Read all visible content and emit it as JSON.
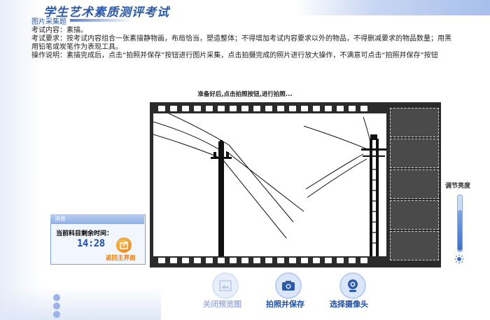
{
  "header": {
    "title": "学生艺术素质测评考试",
    "section_label": "图片采集题"
  },
  "instructions": {
    "line1": "考试内容：素描。",
    "line2": "考试要求：按考试内容组合一张素描静物画，布局恰当，塑造整体；不得增加考试内容要求以外的物品，不得删减要求的物品数量；用黑",
    "line3": "用铅笔或炭笔作为表现工具。",
    "line4": "操作说明：素描完成后，点击“拍照并保存”按钮进行图片采集，点击拍摄完成的照片进行放大操作，不满意可点击“拍照并保存”按钮"
  },
  "camera": {
    "status_text": "准备好后,点击拍照按钮,进行拍照..."
  },
  "brightness": {
    "label": "调节亮度",
    "level_percent": 72
  },
  "message_box": {
    "title": "消息",
    "remaining_label": "当前科目剩余时间：",
    "remaining_time": "14:28",
    "back_label": "返回主界面"
  },
  "actions": {
    "close_preview": "关闭预览图",
    "capture_save": "拍照并保存",
    "select_camera": "选择摄像头"
  },
  "colors": {
    "accent": "#2d5aa6",
    "film": "#2b2b2b",
    "warn": "#e57d12"
  }
}
